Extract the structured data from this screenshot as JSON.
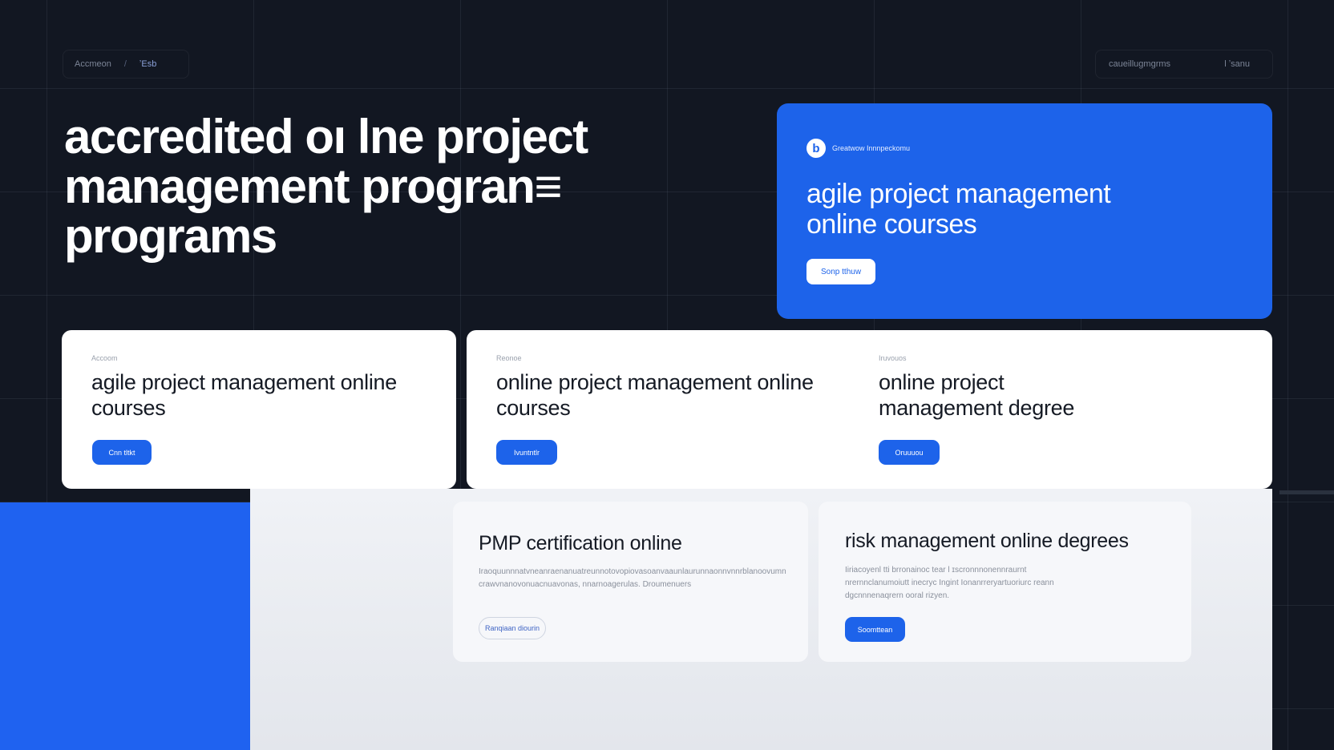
{
  "nav": {
    "left": {
      "crumb_1": "Accmeon",
      "separator": "/",
      "crumb_2": "ʼEsb"
    },
    "right": {
      "link": "caueillugmgrms",
      "action": "l ʼsanu"
    }
  },
  "hero": {
    "title": "accredited oı lne project management progran≡ programs"
  },
  "feature": {
    "brand_logo": "b",
    "brand_name": "Greatwow Innnpeckomu",
    "title": "agile project management online courses",
    "button": "Sonp tthuw"
  },
  "cards": [
    {
      "eyebrow": "Accoom",
      "title": "agile project management online courses",
      "button": "Cnn tltkt"
    },
    {
      "eyebrow": "Reonoe",
      "title": "online project management online courses",
      "button": "Ivuntntlr"
    },
    {
      "eyebrow": "Iruvouos",
      "title": "online project management degree",
      "button": "Oruuuou"
    }
  ],
  "lower_cards": [
    {
      "title": "PMP certification online",
      "body": "Iraoquunnnatvneanraenanuatreunnotovopiovasoanvaaunlaurunnaonnvnnrblanoovumn crawvnanovonuacnuavonas, nnarnoagerulas. Droumenuers",
      "button": "Ranqiaan diourin"
    },
    {
      "title": "risk management online degrees",
      "body": "Iiriacoyenl tti brronainoc tear l ɪscronnnonennraurnt nrernnclanumoiutt inecryc Ingint Ionanrreryartuoriurc reann dgcnnnenaqrern ooral rizyen.",
      "button": "Soomttean"
    }
  ]
}
